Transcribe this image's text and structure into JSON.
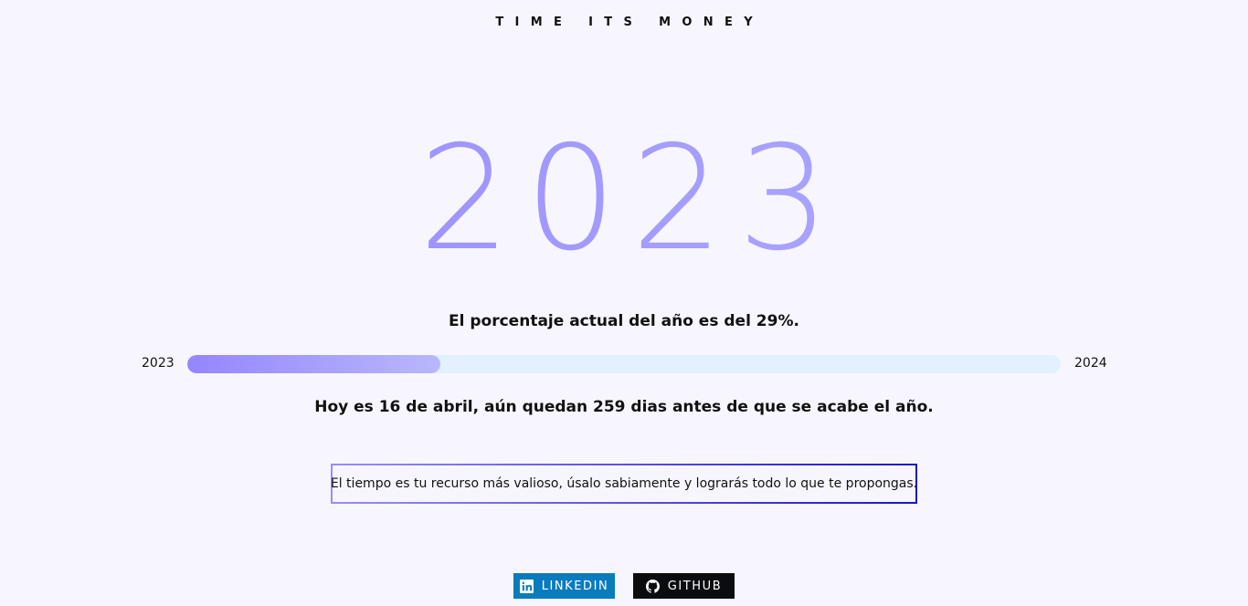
{
  "header": {
    "brand": "TIME ITS MONEY"
  },
  "main": {
    "year": "2023",
    "percent_text": "El porcentaje actual del año es del 29%.",
    "progress": {
      "start_label": "2023",
      "end_label": "2024",
      "percent": 29
    },
    "remaining_text": "Hoy es 16 de abril, aún quedan 259 dias antes de que se acabe el año.",
    "quote": "El tiempo es tu recurso más valioso, úsalo sabiamente y lograrás todo lo que te propongas."
  },
  "social": {
    "linkedin": {
      "label": "LINKEDIN",
      "icon": "linkedin-icon",
      "color": "#0a7bbd"
    },
    "github": {
      "label": "GITHUB",
      "icon": "github-icon",
      "color": "#0b0c10"
    }
  },
  "colors": {
    "accent_start": "#9585ff",
    "accent_end": "#b3b2ff",
    "track": "#e3f0fd",
    "background": "#f7f6fe"
  }
}
